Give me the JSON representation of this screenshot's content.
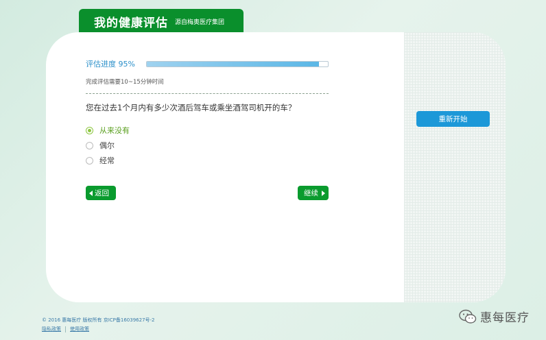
{
  "header": {
    "title": "我的健康评估",
    "subtitle": "源自梅奥医疗集团"
  },
  "progress": {
    "label": "评估进度 95%",
    "value_percent": 95,
    "time_note": "完成评估需要10~15分钟时间"
  },
  "question": {
    "text": "您在过去1个月内有多少次酒后驾车或乘坐酒驾司机开的车？",
    "options": [
      {
        "label": "从来没有",
        "selected": true
      },
      {
        "label": "偶尔",
        "selected": false
      },
      {
        "label": "经常",
        "selected": false
      }
    ]
  },
  "nav": {
    "back_label": "返回",
    "next_label": "继续"
  },
  "sidebar": {
    "restart_label": "重新开始"
  },
  "footer": {
    "copyright": "© 2016 惠每医疗 版权所有 京ICP备16039627号-2",
    "links": [
      "隐私政策",
      "使用政策"
    ]
  },
  "watermark": {
    "text": "惠每医疗",
    "icon": "wechat-icon"
  },
  "colors": {
    "brand_green": "#0a8f2c",
    "progress_blue": "#5bb7e6",
    "restart_blue": "#1c98d8",
    "selected_green": "#8cc63f"
  }
}
